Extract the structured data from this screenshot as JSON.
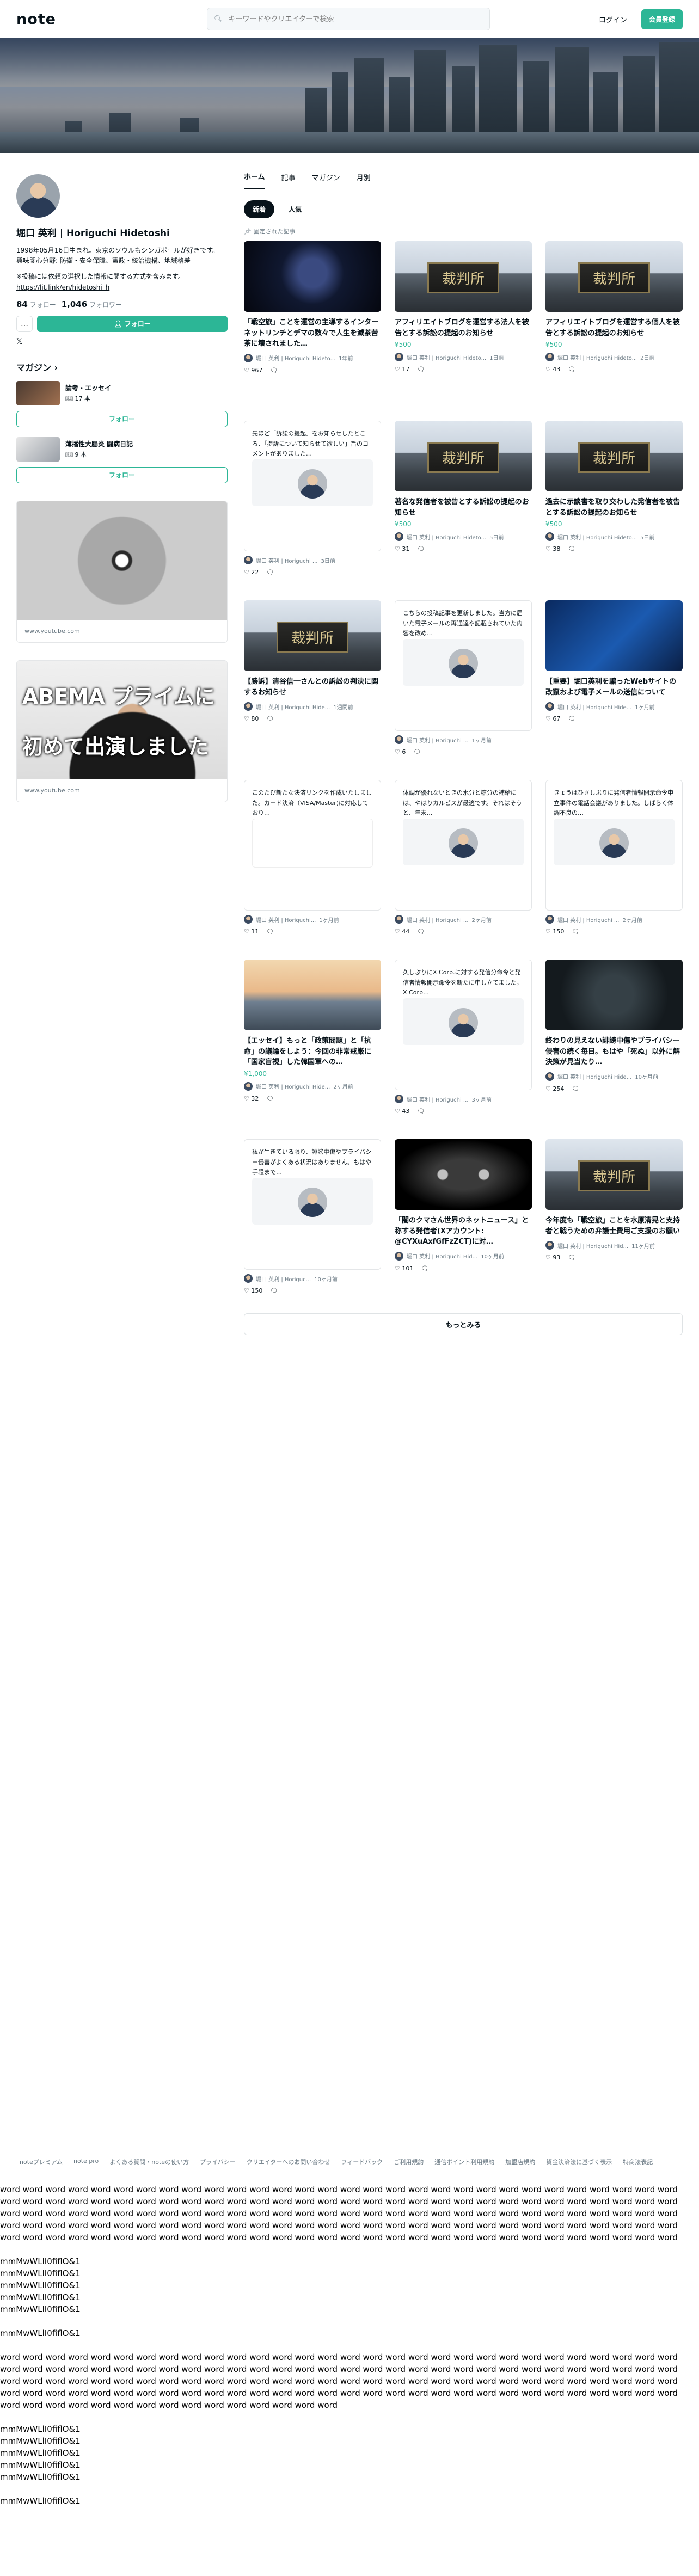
{
  "header": {
    "logo": "note",
    "search_placeholder": "キーワードやクリエイターで検索",
    "login": "ログイン",
    "signup": "会員登録"
  },
  "profile": {
    "name": "堀口 英利 | Horiguchi Hidetoshi",
    "bio_lines": [
      "1998年05月16日生まれ。東京のソウルもシンガポールが好きです。",
      "興味関心分野: 防衛・安全保障、憲政・統治機構、地域格差",
      "※投稿には依頼の選択した情報に関する方式を含みます。"
    ],
    "link": "https://lit.link/en/hidetoshi_h",
    "follow_count": "84",
    "follow_label": "フォロー",
    "follower_count": "1,046",
    "follower_label": "フォロワー",
    "more_icon": "…",
    "follow_button": "フォロー",
    "x_icon": "𝕏"
  },
  "magazines": {
    "title": "マガジン",
    "items": [
      {
        "name": "論考・エッセイ",
        "count": "17 本",
        "button": "フォロー"
      },
      {
        "name": "薄播性大腸炎 闘病日記",
        "count": "9 本",
        "button": "フォロー"
      }
    ]
  },
  "embeds": [
    {
      "url": "www.youtube.com",
      "caption": ""
    },
    {
      "url": "www.youtube.com",
      "caption": "ABEMA プライムに 初めて出演しました"
    }
  ],
  "tabs": [
    "ホーム",
    "記事",
    "マガジン",
    "月別"
  ],
  "pills": [
    "新着",
    "人気"
  ],
  "pinned_label": "固定された記事",
  "cards": [
    {
      "kind": "img",
      "img": "hacker",
      "title": "「戦空旅」ことを運営の主導するインターネットリンチとデマの数々で人生を滅茶苦茶に壊されました…",
      "price": "",
      "meta": "堀口 英利 | Horiguchi Hideto...",
      "age": "1年前",
      "likes": "967"
    },
    {
      "kind": "img",
      "img": "court",
      "title": "アフィリエイトブログを運営する法人を被告とする訴訟の提起のお知らせ",
      "price": "¥500",
      "meta": "堀口 英利 | Horiguchi Hideto...",
      "age": "1日前",
      "likes": "17"
    },
    {
      "kind": "img",
      "img": "court2",
      "title": "アフィリエイトブログを運営する個人を被告とする訴訟の提起のお知らせ",
      "price": "¥500",
      "meta": "堀口 英利 | Horiguchi Hideto...",
      "age": "2日前",
      "likes": "43"
    },
    {
      "kind": "text",
      "excerpt": "先ほど「訴訟の提起」をお知らせしたところ、「提訴について知らせて欲しい」旨のコメントがありました…",
      "meta": "堀口 英利 | Horiguchi ...",
      "age": "3日前",
      "likes": "22"
    },
    {
      "kind": "img",
      "img": "court",
      "title": "著名な発信者を被告とする訴訟の提起のお知らせ",
      "price": "¥500",
      "meta": "堀口 英利 | Horiguchi Hideto...",
      "age": "5日前",
      "likes": "31"
    },
    {
      "kind": "img",
      "img": "court2",
      "title": "過去に示談書を取り交わした発信者を被告とする訴訟の提起のお知らせ",
      "price": "¥500",
      "meta": "堀口 英利 | Horiguchi Hideto...",
      "age": "5日前",
      "likes": "38"
    },
    {
      "kind": "img",
      "img": "court",
      "title": "【勝訴】清谷信一さんとの訴訟の判決に関するお知らせ",
      "price": "",
      "meta": "堀口 英利 | Horiguchi Hide...",
      "age": "1週間前",
      "likes": "80"
    },
    {
      "kind": "text",
      "excerpt": "こちらの投稿記事を更新しました。当方に届いた電子メールの再通達や記載されていた内容を改め…",
      "meta": "堀口 英利 | Horiguchi ...",
      "age": "1ヶ月前",
      "likes": "6"
    },
    {
      "kind": "img",
      "img": "laptop",
      "title": "【重要】堀口英利を騙ったWebサイトの改竄および電子メールの送信について",
      "price": "",
      "meta": "堀口 英利 | Horiguchi Hide...",
      "age": "1ヶ月前",
      "likes": "67"
    },
    {
      "kind": "docs",
      "excerpt": "このたび新たな決済リンクを作成いたしました。カード決済（VISA/Master)に対応しており…",
      "meta": "堀口 英利 | Horiguchi...",
      "age": "1ヶ月前",
      "likes": "11"
    },
    {
      "kind": "text",
      "excerpt": "体調が優れないときの水分と糖分の補給には、やはりカルピスが最適です。それはそうと、年末…",
      "meta": "堀口 英利 | Horiguchi ...",
      "age": "2ヶ月前",
      "likes": "44"
    },
    {
      "kind": "text",
      "excerpt": "きょうはひさしぶりに発信者情報開示命令申立事件の電話会議がありました。しばらく体調不良の…",
      "meta": "堀口 英利 | Horiguchi ...",
      "age": "2ヶ月前",
      "likes": "150"
    },
    {
      "kind": "img",
      "img": "city",
      "title": "【エッセイ】もっと「政策問題」と「抗命」の議論をしよう：今回の非常戒厳に「国家盲視」した韓国軍への…",
      "price": "¥1,000",
      "meta": "堀口 英利 | Horiguchi Hide...",
      "age": "2ヶ月前",
      "likes": "32"
    },
    {
      "kind": "text",
      "excerpt": "久しぶりにX Corp.に対する発信分命令と発信者情報開示命令を新たに申し立てました。X Corp…",
      "meta": "堀口 英利 | Horiguchi ...",
      "age": "3ヶ月前",
      "likes": "43"
    },
    {
      "kind": "img",
      "img": "dark",
      "title": "終わりの見えない誹謗中傷やプライバシー侵害の続く毎日。もはや「死ぬ」以外に解決策が見当たり…",
      "price": "",
      "meta": "堀口 英利 | Horiguchi Hide...",
      "age": "10ヶ月前",
      "likes": "254"
    },
    {
      "kind": "text",
      "excerpt": "私が生きている限り、誹謗中傷やプライバシー侵害がよくある状況はありません。もはや手段まで…",
      "meta": "堀口 英利 | Horiguc...",
      "age": "10ヶ月前",
      "likes": "150"
    },
    {
      "kind": "img",
      "img": "eyes",
      "title": "「闇のクマさん世界のネットニュース」と称する発信者(Xアカウント: @CYXuAxfGfFzZCT)に対…",
      "price": "",
      "meta": "堀口 英利 | Horiguchi Hid...",
      "age": "10ヶ月前",
      "likes": "101"
    },
    {
      "kind": "img",
      "img": "court2",
      "title": "今年度も「戦空旅」ことを水原清晃と支持者と戦うための弁護士費用ご支援のお願い",
      "price": "",
      "meta": "堀口 英利 | Horiguchi Hid...",
      "age": "11ヶ月前",
      "likes": "93"
    }
  ],
  "more_button": "もっとみる",
  "footer_links": [
    "noteプレミアム",
    "note pro",
    "よくある質問・noteの使い方",
    "プライバシー",
    "クリエイターへのお問い合わせ",
    "フィードバック",
    "ご利用規約",
    "通信ポイント利用規約",
    "加盟店規約",
    "資金決済法に基づく表示",
    "特商法表記"
  ],
  "court_plate": "裁判所",
  "filler_word": "word",
  "filler_specimen": "mmMwWLlI0fiflO&1"
}
